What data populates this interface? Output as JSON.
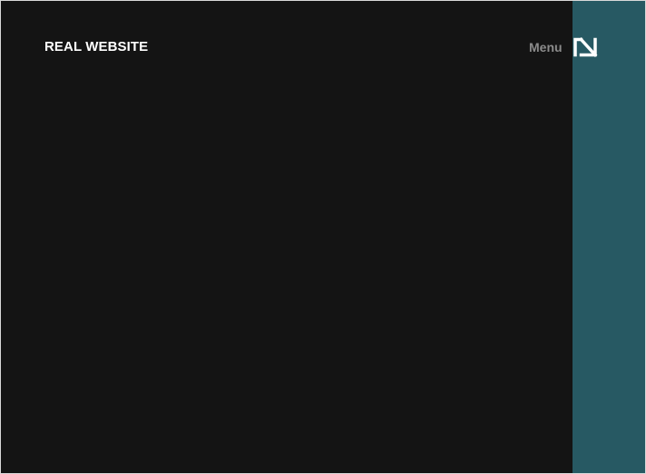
{
  "site": {
    "title": "REAL WEBSITE"
  },
  "header": {
    "menu_label": "Menu",
    "menu_icon": "menu-toggle-icon"
  },
  "colors": {
    "background": "#141414",
    "side_panel": "#275963",
    "logo_text": "#ffffff",
    "menu_text": "#8b8b8b",
    "menu_icon": "#ffffff"
  }
}
